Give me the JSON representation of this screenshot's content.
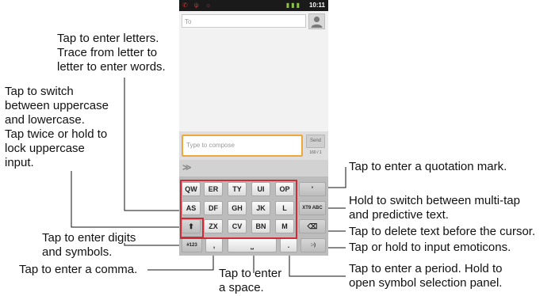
{
  "status": {
    "left_icons": "✆ ψ ☼",
    "signal": "▮▮▮",
    "time": "10:11"
  },
  "message": {
    "to_placeholder": "To",
    "compose_placeholder": "Type to compose",
    "send_label": "Send",
    "counter": "160 / 1"
  },
  "keyboard": {
    "suggest_symbol": "≫",
    "row1": [
      "QW",
      "ER",
      "TY",
      "UI",
      "OP",
      "'"
    ],
    "row2": [
      "AS",
      "DF",
      "GH",
      "JK",
      "L"
    ],
    "xt9": "XT9 ABC",
    "row3": [
      "ZX",
      "CV",
      "BN",
      "M"
    ],
    "shift": "⬆",
    "backspace": "⌫",
    "sym": "#123",
    "comma": ",",
    "space": "⎵",
    "period": ".",
    "emoticon": ":-)"
  },
  "annotations": {
    "letters": [
      "Tap  to enter letters.",
      "Trace from letter to",
      "letter to enter words."
    ],
    "shift": [
      "Tap to switch",
      "between uppercase",
      "and lowercase.",
      "Tap twice or hold to",
      "lock uppercase",
      "input."
    ],
    "digits": [
      "Tap to enter digits",
      "and symbols."
    ],
    "comma": "Tap to enter a comma.",
    "space": [
      "Tap to enter",
      "a space."
    ],
    "quote": "Tap to enter a quotation mark.",
    "predictive": [
      "Hold to switch between multi-tap",
      "and predictive text."
    ],
    "delete": "Tap to delete text before the cursor.",
    "emoticons": "Tap or hold to input emoticons.",
    "period": [
      "Tap to enter a period. Hold to",
      "open symbol selection panel."
    ]
  }
}
